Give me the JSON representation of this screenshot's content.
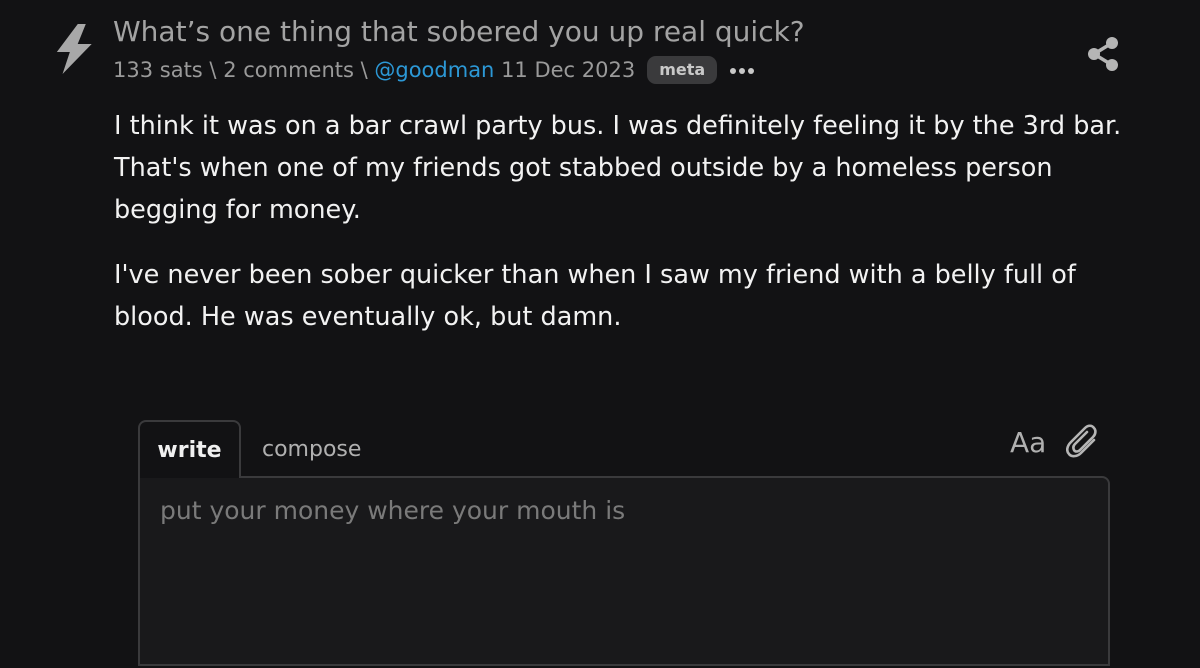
{
  "post": {
    "title": "What’s one thing that sobered you up real quick?",
    "sats": "133 sats",
    "separator": " \\ ",
    "comments": "2 comments",
    "author": "@goodman",
    "date": "11 Dec 2023",
    "badge": "meta",
    "paragraphs": [
      "I think it was on a bar crawl party bus. I was definitely feeling it by the 3rd bar. That's when one of my friends got stabbed outside by a homeless person begging for money.",
      "I've never been sober quicker than when I saw my friend with a belly full of blood. He was eventually ok, but damn."
    ]
  },
  "editor": {
    "tab_write": "write",
    "tab_compose": "compose",
    "text_style_label": "Aa",
    "placeholder": "put your money where your mouth is"
  },
  "icons": {
    "zap": "zap-icon",
    "more": "more-icon",
    "share": "share-icon",
    "attach": "paperclip-icon"
  },
  "colors": {
    "background": "#121214",
    "author_link": "#2c98d6",
    "muted_text": "#a3a3a3"
  }
}
